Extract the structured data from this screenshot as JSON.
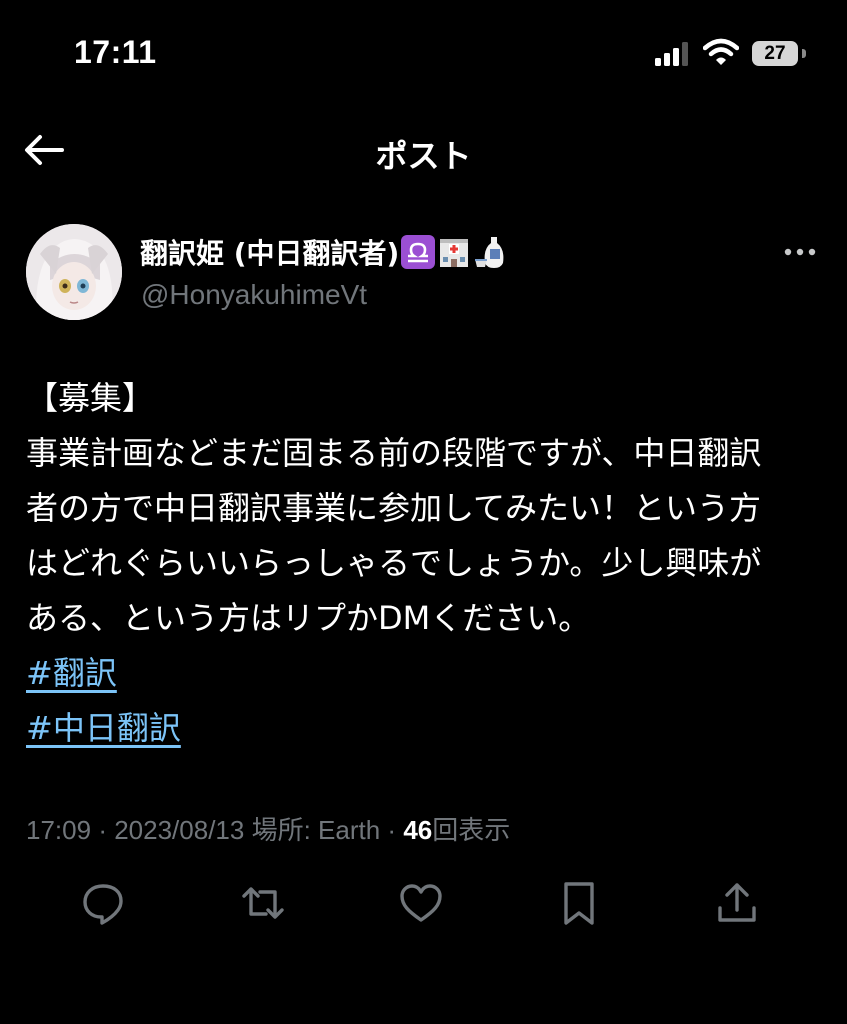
{
  "status_bar": {
    "time": "17:11",
    "battery": "27"
  },
  "header": {
    "title": "ポスト",
    "back_icon": "arrow-left-icon"
  },
  "author": {
    "display_name": "翻訳姫 (中日翻訳者)",
    "emojis": [
      "libra-emoji",
      "hospital-emoji",
      "sake-emoji"
    ],
    "handle": "@HonyakuhimeVt"
  },
  "tweet": {
    "lines": [
      "【募集】",
      "事業計画などまだ固まる前の段階ですが、中日翻訳",
      "者の方で中日翻訳事業に参加してみたい！という方",
      "はどれぐらいいらっしゃるでしょうか。少し興味が",
      "ある、という方はリプかDMください。"
    ],
    "hashtags": [
      "#翻訳",
      "#中日翻訳"
    ]
  },
  "meta": {
    "time": "17:09",
    "date": "2023/08/13",
    "location_label": "場所: Earth",
    "views_count": "46",
    "views_label": "回表示",
    "separator": "·"
  },
  "actions": [
    "reply-icon",
    "retweet-icon",
    "like-icon",
    "bookmark-icon",
    "share-icon"
  ],
  "colors": {
    "background": "#000000",
    "text": "#ffffff",
    "secondary": "#71767b",
    "link": "#7cc4f8"
  }
}
